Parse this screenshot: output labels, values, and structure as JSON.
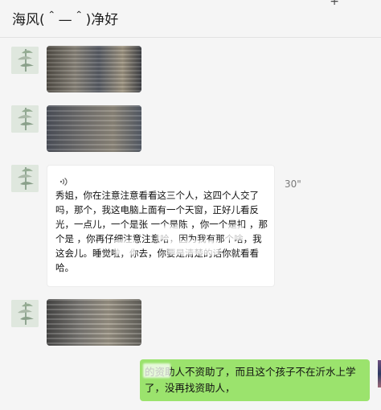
{
  "header": {
    "title": "海风(＾—＾)净好",
    "corner_icon": "+"
  },
  "messages": {
    "voice": {
      "duration": "30\"",
      "text": "秀姐，你在注意注意看看这三个人，这四个人交了吗，那个，我这电脑上面有一个天窗，正好儿看反光，一点儿，一个是张 一个是陈 ，你一个是扣 ，那个是 ，你再仔细注意注意哈，因为我有那个啥，我这会儿。睡觉啦，你去，你要是清楚的话你就看看哈。"
    },
    "outgoing": {
      "text": "的资助人不资助了，而且这个孩子不在沂水上学了，没再找资助人，"
    }
  }
}
